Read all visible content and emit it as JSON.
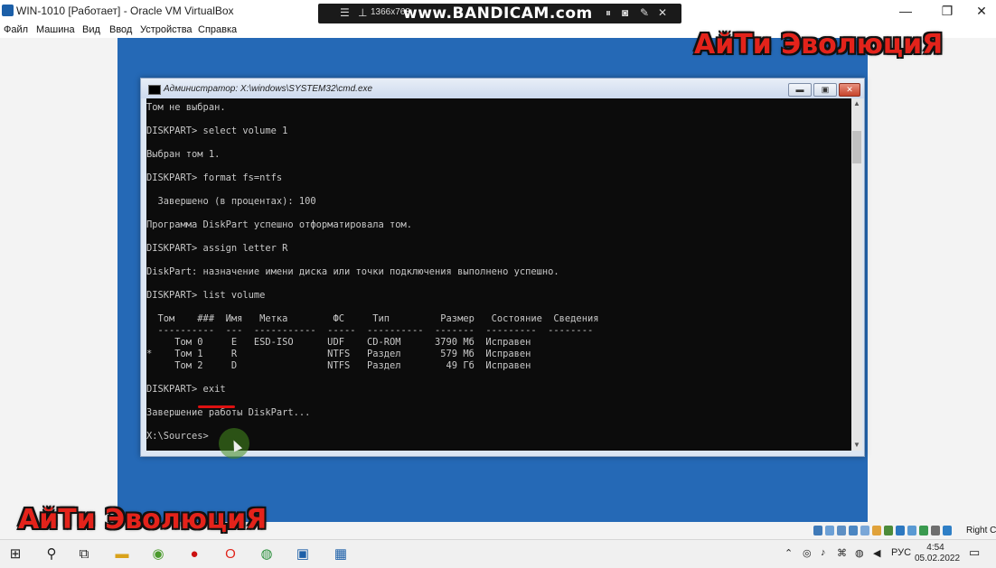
{
  "host_window": {
    "title": "WIN-1010 [Работает] - Oracle VM VirtualBox",
    "menu": [
      "Файл",
      "Машина",
      "Вид",
      "Ввод",
      "Устройства",
      "Справка"
    ],
    "controls": {
      "minimize": "—",
      "maximize": "❐",
      "close": "✕"
    }
  },
  "bandicam": {
    "resolution": "1366x768",
    "logo": "www.BANDICAM.com"
  },
  "watermark": "АйТи ЭволюциЯ",
  "cmd_window": {
    "title": "Администратор: X:\\windows\\SYSTEM32\\cmd.exe",
    "buttons": {
      "minimize": "▬",
      "maximize": "▣",
      "close": "✕"
    },
    "lines": [
      "Том не выбран.",
      "",
      "DISKPART> select volume 1",
      "",
      "Выбран том 1.",
      "",
      "DISKPART> format fs=ntfs",
      "",
      "  Завершено (в процентах): 100",
      "",
      "Программа DiskPart успешно отформатировала том.",
      "",
      "DISKPART> assign letter R",
      "",
      "DiskPart: назначение имени диска или точки подключения выполнено успешно.",
      "",
      "DISKPART> list volume",
      "",
      "  Том    ###  Имя   Метка        ФС     Тип         Размер   Состояние  Сведения",
      "  ----------  ---  -----------  -----  ----------  -------  ---------  --------",
      "     Том 0     E   ESD-ISO      UDF    CD-ROM      3790 Мб  Исправен",
      "*    Том 1     R                NTFS   Раздел       579 Мб  Исправен",
      "     Том 2     D                NTFS   Раздел        49 Гб  Исправен",
      "",
      "DISKPART> exit",
      "",
      "Завершение работы DiskPart...",
      "",
      "X:\\Sources>"
    ]
  },
  "vm_status": {
    "host_key": "Right Ctrl"
  },
  "taskbar": {
    "tray_language": "РУС",
    "time": "4:54",
    "date": "05.02.2022"
  },
  "colors": {
    "vm_background": "#2569b6",
    "console_background": "#0c0c0c",
    "console_text": "#c8c8c8",
    "watermark_red": "#e3231b",
    "underline_red": "#dd1111"
  }
}
